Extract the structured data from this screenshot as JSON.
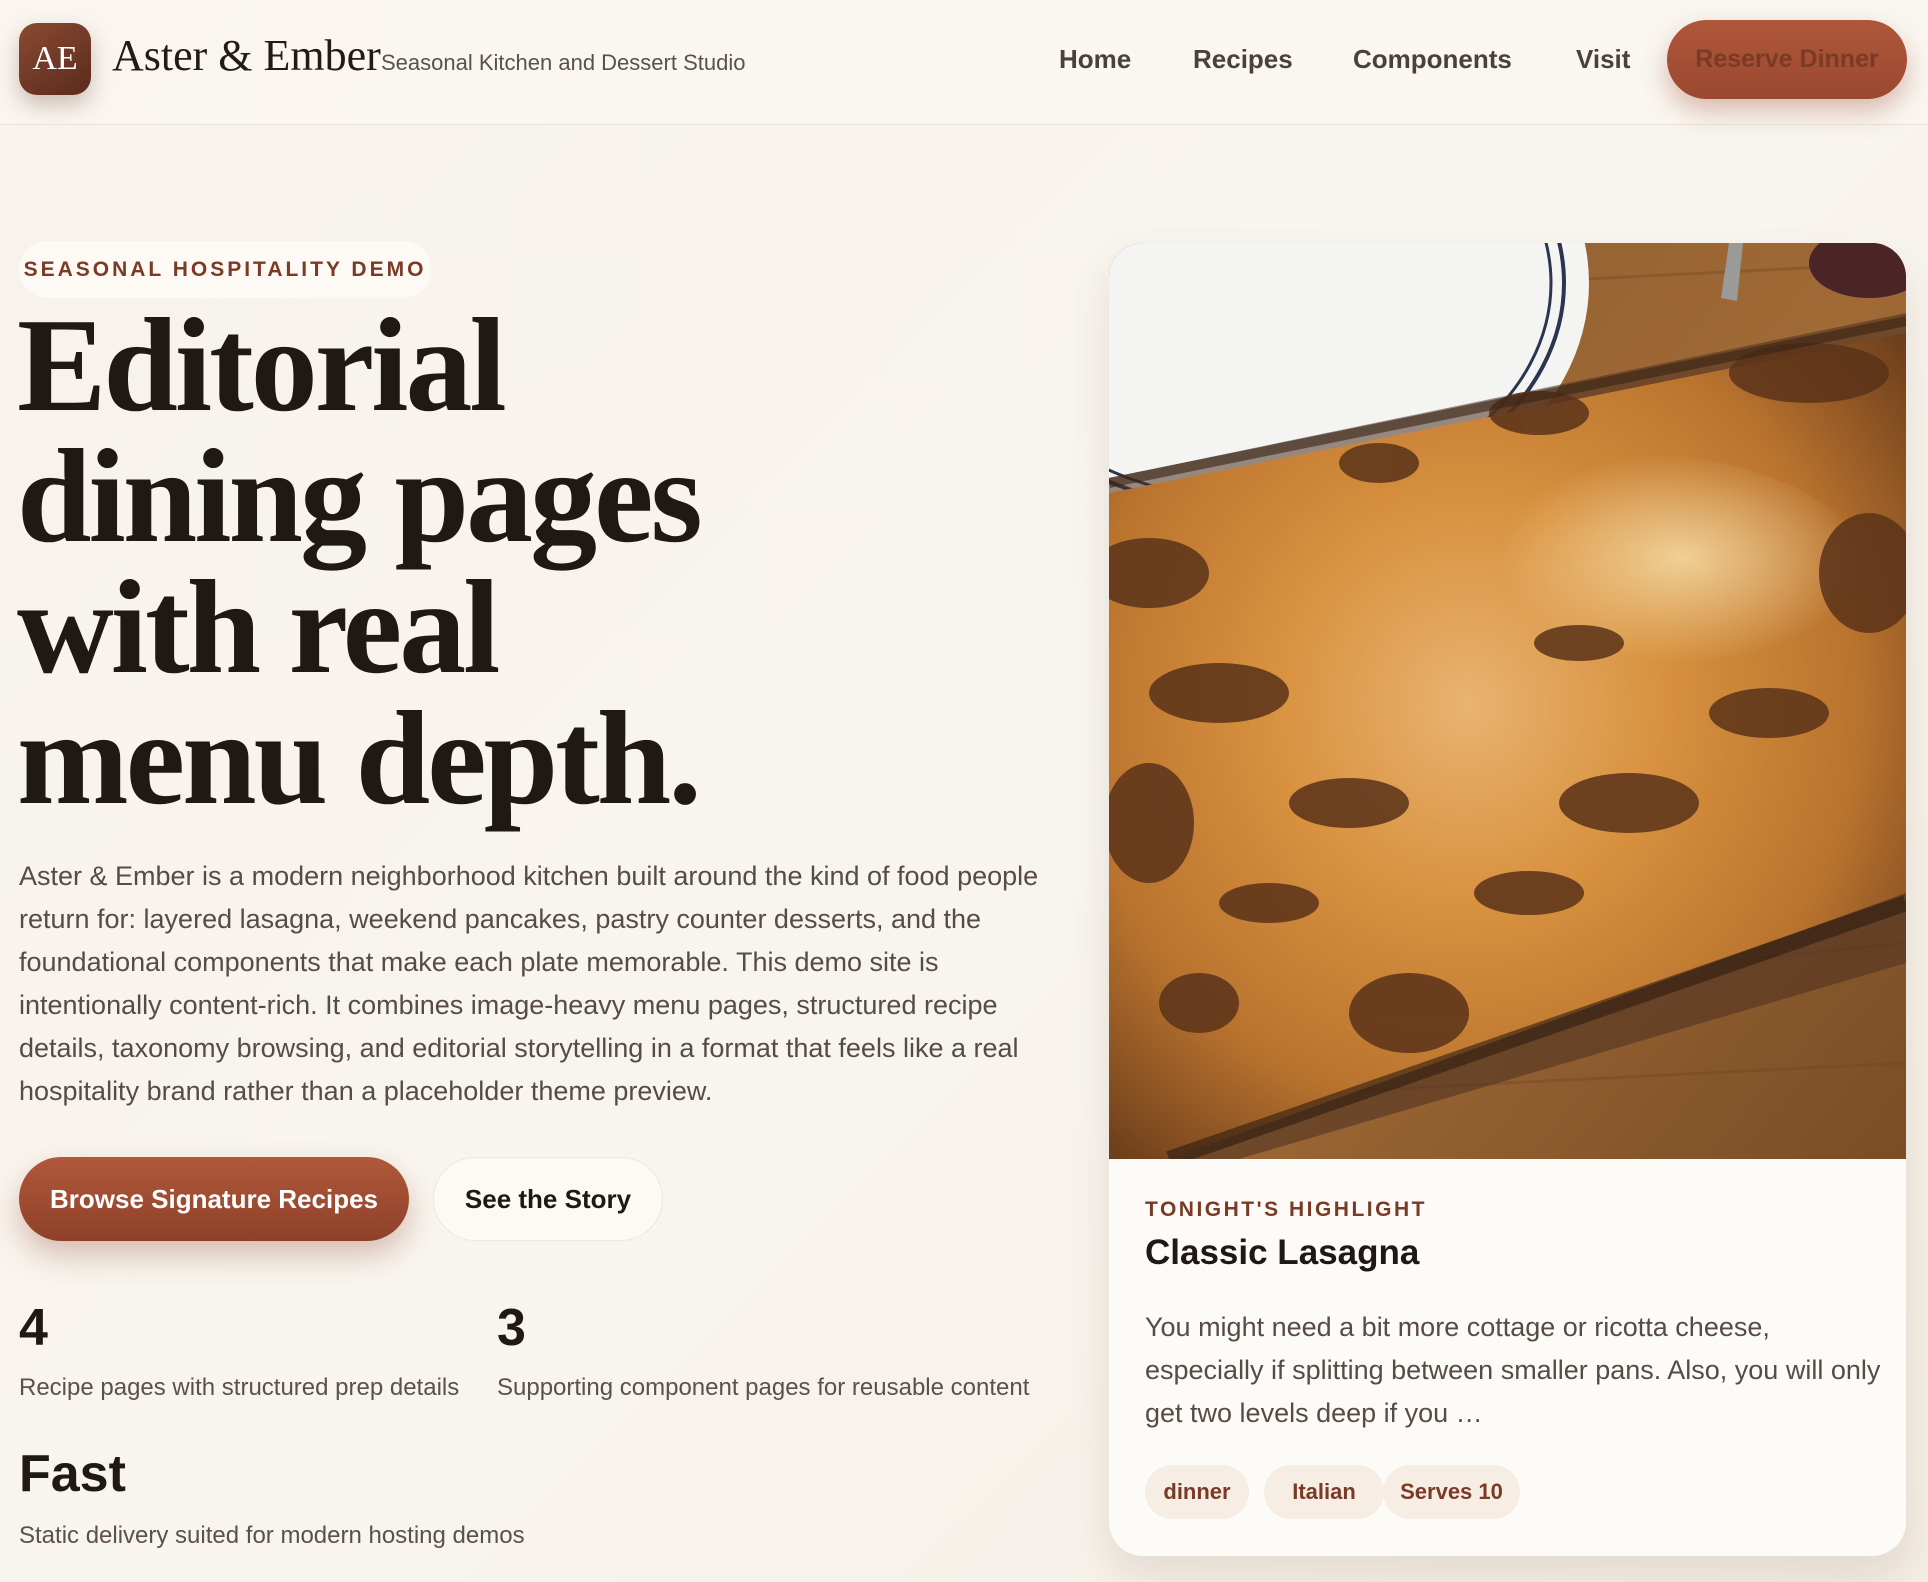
{
  "header": {
    "logo_text": "AE",
    "brand_name": "Aster & Ember",
    "tagline": "Seasonal Kitchen and Dessert Studio",
    "nav": [
      {
        "label": "Home"
      },
      {
        "label": "Recipes"
      },
      {
        "label": "Components"
      },
      {
        "label": "Visit"
      }
    ],
    "cta_label": "Reserve Dinner"
  },
  "hero": {
    "eyebrow": "SEASONAL HOSPITALITY DEMO",
    "title_lines": [
      "Editorial",
      "dining pages",
      "with real",
      "menu depth."
    ],
    "body": "Aster & Ember is a modern neighborhood kitchen built around the kind of food people return for: layered lasagna, weekend pancakes, pastry counter desserts, and the foundational components that make each plate memorable. This demo site is intentionally content-rich. It combines image-heavy menu pages, structured recipe details, taxonomy browsing, and editorial storytelling in a format that feels like a real hospitality brand rather than a placeholder theme preview.",
    "primary_cta": "Browse Signature Recipes",
    "secondary_cta": "See the Story",
    "stats": [
      {
        "value": "4",
        "label": "Recipe pages with structured prep details"
      },
      {
        "value": "3",
        "label": "Supporting component pages for reusable content"
      },
      {
        "value": "Fast",
        "label": "Static delivery suited for modern hosting demos"
      }
    ]
  },
  "highlight": {
    "eyebrow": "TONIGHT'S HIGHLIGHT",
    "title": "Classic Lasagna",
    "body": "You might need a bit more cottage or ricotta cheese, especially if splitting between smaller pans. Also, you will only get two levels deep if you …",
    "tags": [
      "dinner",
      "Italian",
      "Serves 10"
    ]
  },
  "colors": {
    "accent": "#9a4830",
    "accent_text": "#7a3a25",
    "ink": "#1f1814",
    "background": "#f7f2ec"
  }
}
